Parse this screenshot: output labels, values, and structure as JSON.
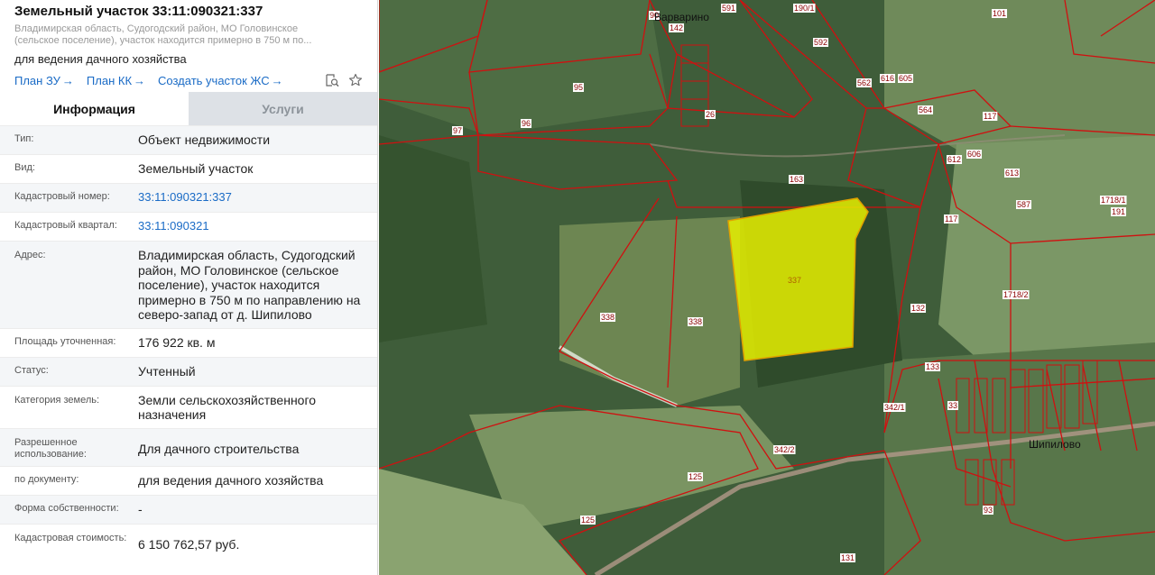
{
  "header": {
    "title": "Земельный участок 33:11:090321:337",
    "subtitle_line1": "Владимирская область, Судогодский район, МО Головинское",
    "subtitle_line2": "(сельское поселение), участок находится примерно в 750 м по...",
    "purpose": "для ведения дачного хозяйства",
    "links": [
      {
        "label": "План ЗУ",
        "arrow": "→"
      },
      {
        "label": "План КК",
        "arrow": "→"
      },
      {
        "label": "Создать участок ЖС",
        "arrow": "→"
      }
    ]
  },
  "tabs": [
    {
      "label": "Информация",
      "active": true
    },
    {
      "label": "Услуги",
      "active": false
    }
  ],
  "info": [
    {
      "label": "Тип:",
      "value": "Объект недвижимости"
    },
    {
      "label": "Вид:",
      "value": "Земельный участок"
    },
    {
      "label": "Кадастровый номер:",
      "value": "33:11:090321:337",
      "link": true
    },
    {
      "label": "Кадастровый квартал:",
      "value": "33:11:090321",
      "link": true
    },
    {
      "label": "Адрес:",
      "value": "Владимирская область, Судогодский район, МО Головинское (сельское поселение), участок находится примерно в 750 м по направлению на северо-запад от д. Шипилово"
    },
    {
      "label": "Площадь уточненная:",
      "value": "176 922 кв. м"
    },
    {
      "label": "Статус:",
      "value": "Учтенный"
    },
    {
      "label": "Категория земель:",
      "value": "Земли сельскохозяйственного назначения"
    },
    {
      "label": "Разрешенное использование:",
      "value": "Для дачного строительства"
    },
    {
      "label": "по документу:",
      "value": "для ведения дачного хозяйства"
    },
    {
      "label": "Форма собственности:",
      "value": "-"
    },
    {
      "label": "Кадастровая стоимость:",
      "value": "6 150 762,57 руб."
    }
  ],
  "map": {
    "selected_parcel": "337",
    "villages": [
      "Варварино",
      "Шипилово"
    ],
    "parcel_labels": [
      "90",
      "142",
      "591",
      "190/1",
      "95",
      "96",
      "97",
      "26",
      "592",
      "562",
      "616",
      "605",
      "564",
      "117",
      "612",
      "606",
      "613",
      "101",
      "163",
      "117",
      "587",
      "1718/1",
      "191",
      "338",
      "338",
      "132",
      "1718/2",
      "133",
      "342/1",
      "342/2",
      "125",
      "125",
      "33",
      "93",
      "131"
    ],
    "colors": {
      "selected_fill": "#e6f000",
      "boundary": "#d01010"
    }
  }
}
